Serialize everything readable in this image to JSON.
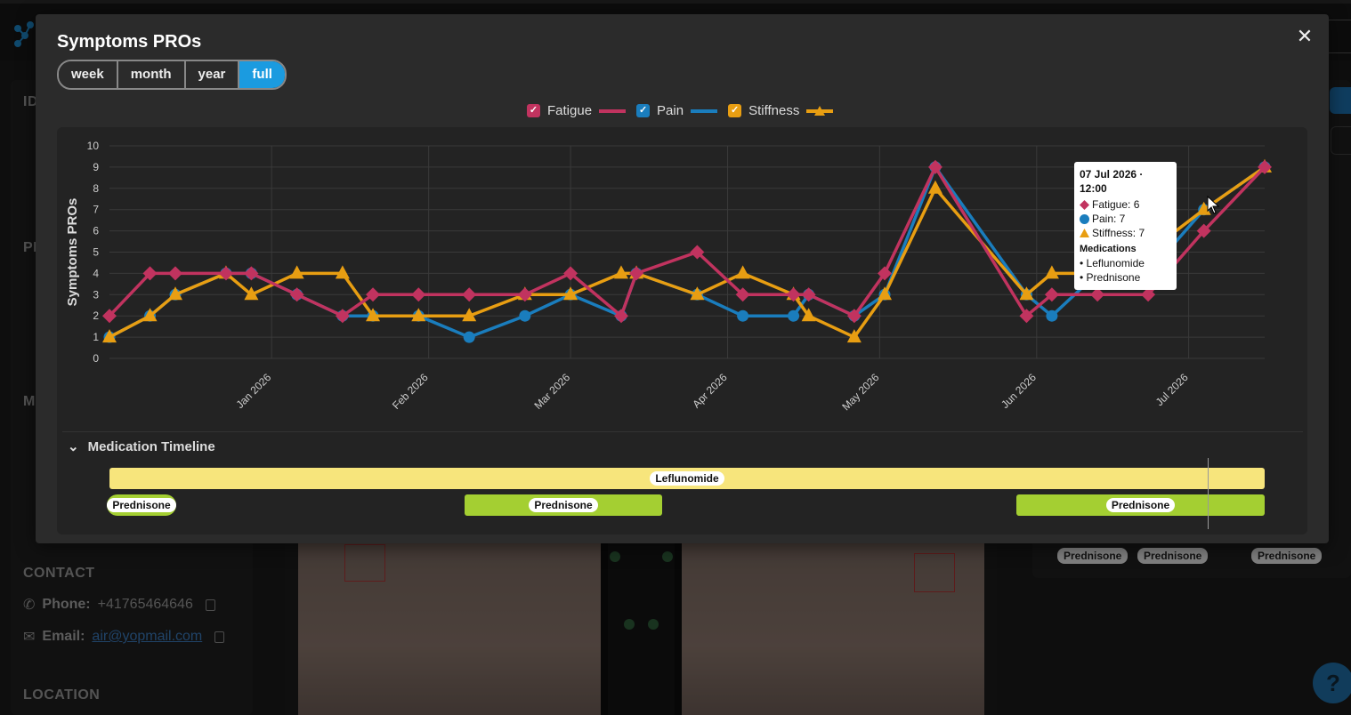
{
  "background": {
    "contact_heading": "CONTACT",
    "phone_label": "Phone:",
    "phone_value": "+41765464646",
    "email_label": "Email:",
    "email_value": "air@yopmail.com",
    "location_heading": "LOCATION",
    "sidebar_fragments": [
      "ID",
      "PI",
      "M"
    ],
    "right_pills": [
      "Prednisone",
      "Prednisone",
      "Prednisone"
    ],
    "help_label": "?"
  },
  "modal": {
    "title": "Symptoms PROs",
    "close_label": "✕",
    "ranges": [
      {
        "label": "week",
        "active": false
      },
      {
        "label": "month",
        "active": false
      },
      {
        "label": "year",
        "active": false
      },
      {
        "label": "full",
        "active": true
      }
    ],
    "legend": [
      {
        "label": "Fatigue",
        "color": "#c1335f",
        "marker": "diamond"
      },
      {
        "label": "Pain",
        "color": "#1a7dbd",
        "marker": "circle"
      },
      {
        "label": "Stiffness",
        "color": "#e89e12",
        "marker": "triangle"
      }
    ],
    "tooltip": {
      "title": "07 Jul 2026 · 12:00",
      "fatigue": "Fatigue: 6",
      "pain": "Pain: 7",
      "stiffness": "Stiffness: 7",
      "medications_heading": "Medications",
      "med1": "• Leflunomide",
      "med2": "• Prednisone"
    },
    "medication_timeline": {
      "heading": "Medication Timeline",
      "bars": [
        {
          "label": "Leflunomide",
          "color": "#f7e57c"
        },
        {
          "label": "Prednisone",
          "color": "#a4cf32"
        },
        {
          "label": "Prednisone",
          "color": "#a4cf32"
        },
        {
          "label": "Prednisone",
          "color": "#a4cf32"
        }
      ]
    }
  },
  "chart_data": {
    "type": "line",
    "ylabel": "Symptoms PROs",
    "ylim": [
      0,
      10
    ],
    "yticks": [
      "0",
      "1",
      "2",
      "3",
      "4",
      "5",
      "6",
      "7",
      "8",
      "9",
      "10"
    ],
    "xticks": [
      "Jan 2026",
      "Feb 2026",
      "Mar 2026",
      "Apr 2026",
      "May 2026",
      "Jun 2026",
      "Jul 2026"
    ],
    "xtick_days": [
      32,
      63,
      91,
      122,
      152,
      183,
      213
    ],
    "grid": true,
    "legend_position": "top-center",
    "x_days": [
      0,
      8,
      13,
      23,
      28,
      37,
      46,
      52,
      61,
      71,
      82,
      91,
      101,
      104,
      116,
      125,
      135,
      138,
      147,
      153,
      163,
      181,
      186,
      195,
      205,
      216,
      228
    ],
    "series": [
      {
        "name": "Fatigue",
        "color": "#c1335f",
        "marker": "diamond",
        "values": [
          2,
          4,
          4,
          4,
          4,
          3,
          2,
          3,
          3,
          3,
          3,
          4,
          2,
          4,
          5,
          3,
          3,
          3,
          2,
          4,
          9,
          2,
          3,
          3,
          3,
          6,
          9
        ]
      },
      {
        "name": "Pain",
        "color": "#1a7dbd",
        "marker": "circle",
        "values": [
          1,
          2,
          3,
          4,
          4,
          3,
          2,
          2,
          2,
          1,
          2,
          3,
          2,
          4,
          3,
          2,
          2,
          3,
          2,
          3,
          9,
          3,
          2,
          4,
          4,
          7,
          9
        ]
      },
      {
        "name": "Stiffness",
        "color": "#e89e12",
        "marker": "triangle",
        "values": [
          1,
          2,
          3,
          4,
          3,
          4,
          4,
          2,
          2,
          2,
          3,
          3,
          4,
          4,
          3,
          4,
          3,
          2,
          1,
          3,
          8,
          3,
          4,
          4,
          5,
          7,
          9
        ]
      }
    ]
  }
}
